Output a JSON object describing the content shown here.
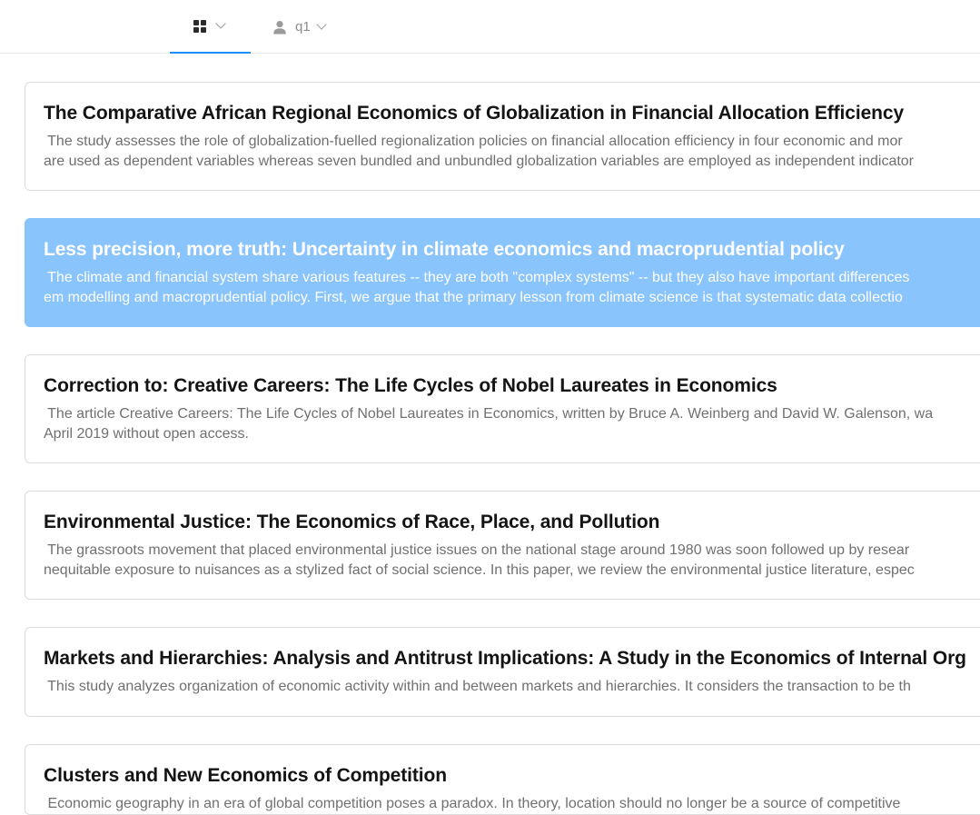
{
  "header": {
    "apps_icon": "grid-icon",
    "user_icon": "user-icon",
    "user_name": "q1"
  },
  "papers": [
    {
      "title": "The Comparative African Regional Economics of Globalization in Financial Allocation Efficiency",
      "abstract_line1": " The study assesses the role of globalization-fuelled regionalization policies on financial allocation efficiency in four economic and mor",
      "abstract_line2": "are used as dependent variables whereas seven bundled and unbundled globalization variables are employed as independent indicator",
      "selected": false
    },
    {
      "title": "Less precision, more truth: Uncertainty in climate economics and macroprudential policy",
      "abstract_line1": " The climate and financial system share various features -- they are both \"complex systems\" -- but they also have important differences",
      "abstract_line2": "em modelling and macroprudential policy. First, we argue that the primary lesson from climate science is that systematic data collectio",
      "selected": true
    },
    {
      "title": "Correction to: Creative Careers: The Life Cycles of Nobel Laureates in Economics",
      "abstract_line1": " The article Creative Careers: The Life Cycles of Nobel Laureates in Economics, written by Bruce A. Weinberg and David W. Galenson, wa",
      "abstract_line2": "April 2019 without open access.",
      "selected": false
    },
    {
      "title": "Environmental Justice: The Economics of Race, Place, and Pollution",
      "abstract_line1": " The grassroots movement that placed environmental justice issues on the national stage around 1980 was soon followed up by resear",
      "abstract_line2": "nequitable exposure to nuisances as a stylized fact of social science. In this paper, we review the environmental justice literature, espec",
      "selected": false
    },
    {
      "title": "Markets and Hierarchies: Analysis and Antitrust Implications: A Study in the Economics of Internal Org",
      "abstract_line1": " This study analyzes organization of economic activity within and between markets and hierarchies. It considers the transaction to be th",
      "abstract_line2": "",
      "selected": false
    },
    {
      "title": "Clusters and New Economics of Competition",
      "abstract_line1": " Economic geography in an era of global competition poses a paradox. In theory, location should no longer be a source of competitive",
      "abstract_line2": "",
      "selected": false
    }
  ]
}
